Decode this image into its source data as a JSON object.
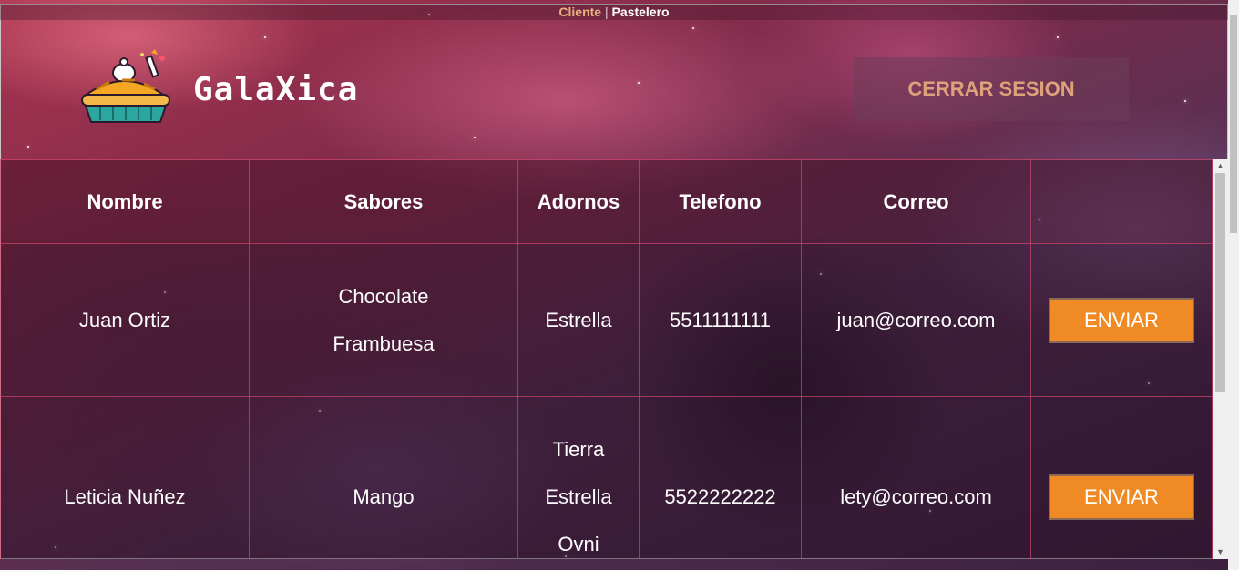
{
  "topnav": {
    "cliente": "Cliente",
    "separator": "|",
    "pastelero": "Pastelero"
  },
  "header": {
    "brand": "GalaXica",
    "logout_label": "CERRAR SESION"
  },
  "table": {
    "columns": [
      "Nombre",
      "Sabores",
      "Adornos",
      "Telefono",
      "Correo",
      ""
    ],
    "rows": [
      {
        "nombre": "Juan Ortiz",
        "sabores": [
          "Chocolate",
          "Frambuesa"
        ],
        "adornos": [
          "Estrella"
        ],
        "telefono": "5511111111",
        "correo": "juan@correo.com",
        "action": "ENVIAR"
      },
      {
        "nombre": "Leticia Nuñez",
        "sabores": [
          "Mango"
        ],
        "adornos": [
          "Tierra",
          "Estrella",
          "Ovni"
        ],
        "telefono": "5522222222",
        "correo": "lety@correo.com",
        "action": "ENVIAR"
      }
    ]
  },
  "colors": {
    "accent": "#f08a25",
    "logout_text": "#dea27a",
    "cliente_link": "#e7b27d"
  },
  "icons": {
    "logo": "pie-rocket-icon"
  }
}
